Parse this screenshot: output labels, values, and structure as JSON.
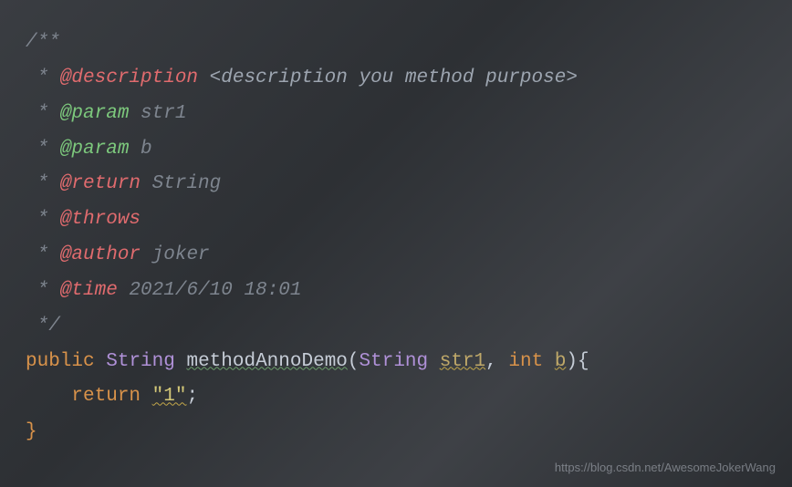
{
  "code": {
    "comment_open": "/**",
    "star": " * ",
    "desc_tag": "@description",
    "desc_placeholder": " <description you method purpose>",
    "param_tag": "@param",
    "param1": " str1",
    "param2": " b",
    "return_tag": "@return",
    "return_type": " String",
    "throws_tag": "@throws",
    "author_tag": "@author",
    "author_val": " joker",
    "time_tag": "@time",
    "time_val": " 2021/6/10 18:01",
    "comment_close": " */",
    "kw_public": "public",
    "type_string": "String",
    "method_name": "methodAnnoDemo",
    "param_str1": "str1",
    "kw_int": "int",
    "param_b": "b",
    "kw_return": "return",
    "string_literal": "\"1\"",
    "brace_open": "{",
    "brace_close": "}",
    "paren_open": "(",
    "paren_close": ")",
    "comma": ", ",
    "semicolon": ";"
  },
  "watermark": "https://blog.csdn.net/AwesomeJokerWang"
}
